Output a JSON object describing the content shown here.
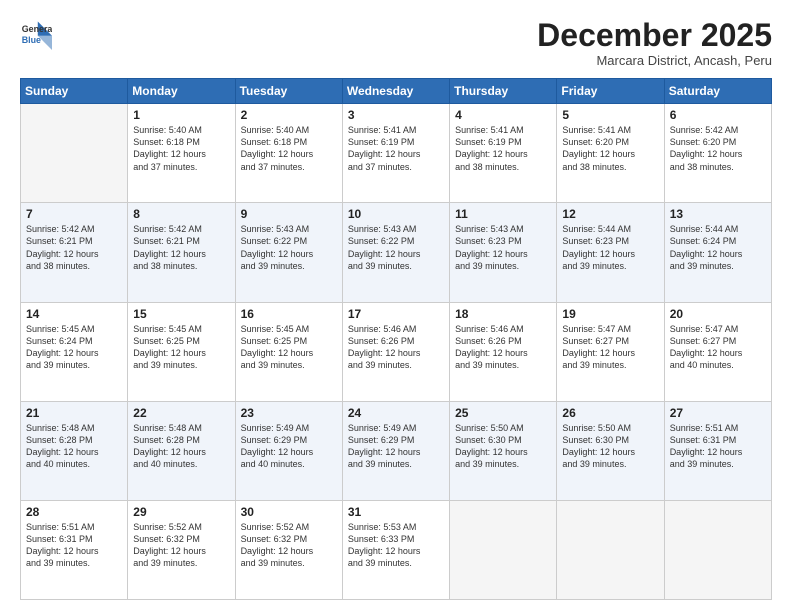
{
  "logo": {
    "general": "General",
    "blue": "Blue"
  },
  "header": {
    "month": "December 2025",
    "location": "Marcara District, Ancash, Peru"
  },
  "weekdays": [
    "Sunday",
    "Monday",
    "Tuesday",
    "Wednesday",
    "Thursday",
    "Friday",
    "Saturday"
  ],
  "weeks": [
    [
      {
        "day": "",
        "info": ""
      },
      {
        "day": "1",
        "info": "Sunrise: 5:40 AM\nSunset: 6:18 PM\nDaylight: 12 hours\nand 37 minutes."
      },
      {
        "day": "2",
        "info": "Sunrise: 5:40 AM\nSunset: 6:18 PM\nDaylight: 12 hours\nand 37 minutes."
      },
      {
        "day": "3",
        "info": "Sunrise: 5:41 AM\nSunset: 6:19 PM\nDaylight: 12 hours\nand 37 minutes."
      },
      {
        "day": "4",
        "info": "Sunrise: 5:41 AM\nSunset: 6:19 PM\nDaylight: 12 hours\nand 38 minutes."
      },
      {
        "day": "5",
        "info": "Sunrise: 5:41 AM\nSunset: 6:20 PM\nDaylight: 12 hours\nand 38 minutes."
      },
      {
        "day": "6",
        "info": "Sunrise: 5:42 AM\nSunset: 6:20 PM\nDaylight: 12 hours\nand 38 minutes."
      }
    ],
    [
      {
        "day": "7",
        "info": "Sunrise: 5:42 AM\nSunset: 6:21 PM\nDaylight: 12 hours\nand 38 minutes."
      },
      {
        "day": "8",
        "info": "Sunrise: 5:42 AM\nSunset: 6:21 PM\nDaylight: 12 hours\nand 38 minutes."
      },
      {
        "day": "9",
        "info": "Sunrise: 5:43 AM\nSunset: 6:22 PM\nDaylight: 12 hours\nand 39 minutes."
      },
      {
        "day": "10",
        "info": "Sunrise: 5:43 AM\nSunset: 6:22 PM\nDaylight: 12 hours\nand 39 minutes."
      },
      {
        "day": "11",
        "info": "Sunrise: 5:43 AM\nSunset: 6:23 PM\nDaylight: 12 hours\nand 39 minutes."
      },
      {
        "day": "12",
        "info": "Sunrise: 5:44 AM\nSunset: 6:23 PM\nDaylight: 12 hours\nand 39 minutes."
      },
      {
        "day": "13",
        "info": "Sunrise: 5:44 AM\nSunset: 6:24 PM\nDaylight: 12 hours\nand 39 minutes."
      }
    ],
    [
      {
        "day": "14",
        "info": "Sunrise: 5:45 AM\nSunset: 6:24 PM\nDaylight: 12 hours\nand 39 minutes."
      },
      {
        "day": "15",
        "info": "Sunrise: 5:45 AM\nSunset: 6:25 PM\nDaylight: 12 hours\nand 39 minutes."
      },
      {
        "day": "16",
        "info": "Sunrise: 5:45 AM\nSunset: 6:25 PM\nDaylight: 12 hours\nand 39 minutes."
      },
      {
        "day": "17",
        "info": "Sunrise: 5:46 AM\nSunset: 6:26 PM\nDaylight: 12 hours\nand 39 minutes."
      },
      {
        "day": "18",
        "info": "Sunrise: 5:46 AM\nSunset: 6:26 PM\nDaylight: 12 hours\nand 39 minutes."
      },
      {
        "day": "19",
        "info": "Sunrise: 5:47 AM\nSunset: 6:27 PM\nDaylight: 12 hours\nand 39 minutes."
      },
      {
        "day": "20",
        "info": "Sunrise: 5:47 AM\nSunset: 6:27 PM\nDaylight: 12 hours\nand 40 minutes."
      }
    ],
    [
      {
        "day": "21",
        "info": "Sunrise: 5:48 AM\nSunset: 6:28 PM\nDaylight: 12 hours\nand 40 minutes."
      },
      {
        "day": "22",
        "info": "Sunrise: 5:48 AM\nSunset: 6:28 PM\nDaylight: 12 hours\nand 40 minutes."
      },
      {
        "day": "23",
        "info": "Sunrise: 5:49 AM\nSunset: 6:29 PM\nDaylight: 12 hours\nand 40 minutes."
      },
      {
        "day": "24",
        "info": "Sunrise: 5:49 AM\nSunset: 6:29 PM\nDaylight: 12 hours\nand 39 minutes."
      },
      {
        "day": "25",
        "info": "Sunrise: 5:50 AM\nSunset: 6:30 PM\nDaylight: 12 hours\nand 39 minutes."
      },
      {
        "day": "26",
        "info": "Sunrise: 5:50 AM\nSunset: 6:30 PM\nDaylight: 12 hours\nand 39 minutes."
      },
      {
        "day": "27",
        "info": "Sunrise: 5:51 AM\nSunset: 6:31 PM\nDaylight: 12 hours\nand 39 minutes."
      }
    ],
    [
      {
        "day": "28",
        "info": "Sunrise: 5:51 AM\nSunset: 6:31 PM\nDaylight: 12 hours\nand 39 minutes."
      },
      {
        "day": "29",
        "info": "Sunrise: 5:52 AM\nSunset: 6:32 PM\nDaylight: 12 hours\nand 39 minutes."
      },
      {
        "day": "30",
        "info": "Sunrise: 5:52 AM\nSunset: 6:32 PM\nDaylight: 12 hours\nand 39 minutes."
      },
      {
        "day": "31",
        "info": "Sunrise: 5:53 AM\nSunset: 6:33 PM\nDaylight: 12 hours\nand 39 minutes."
      },
      {
        "day": "",
        "info": ""
      },
      {
        "day": "",
        "info": ""
      },
      {
        "day": "",
        "info": ""
      }
    ]
  ]
}
